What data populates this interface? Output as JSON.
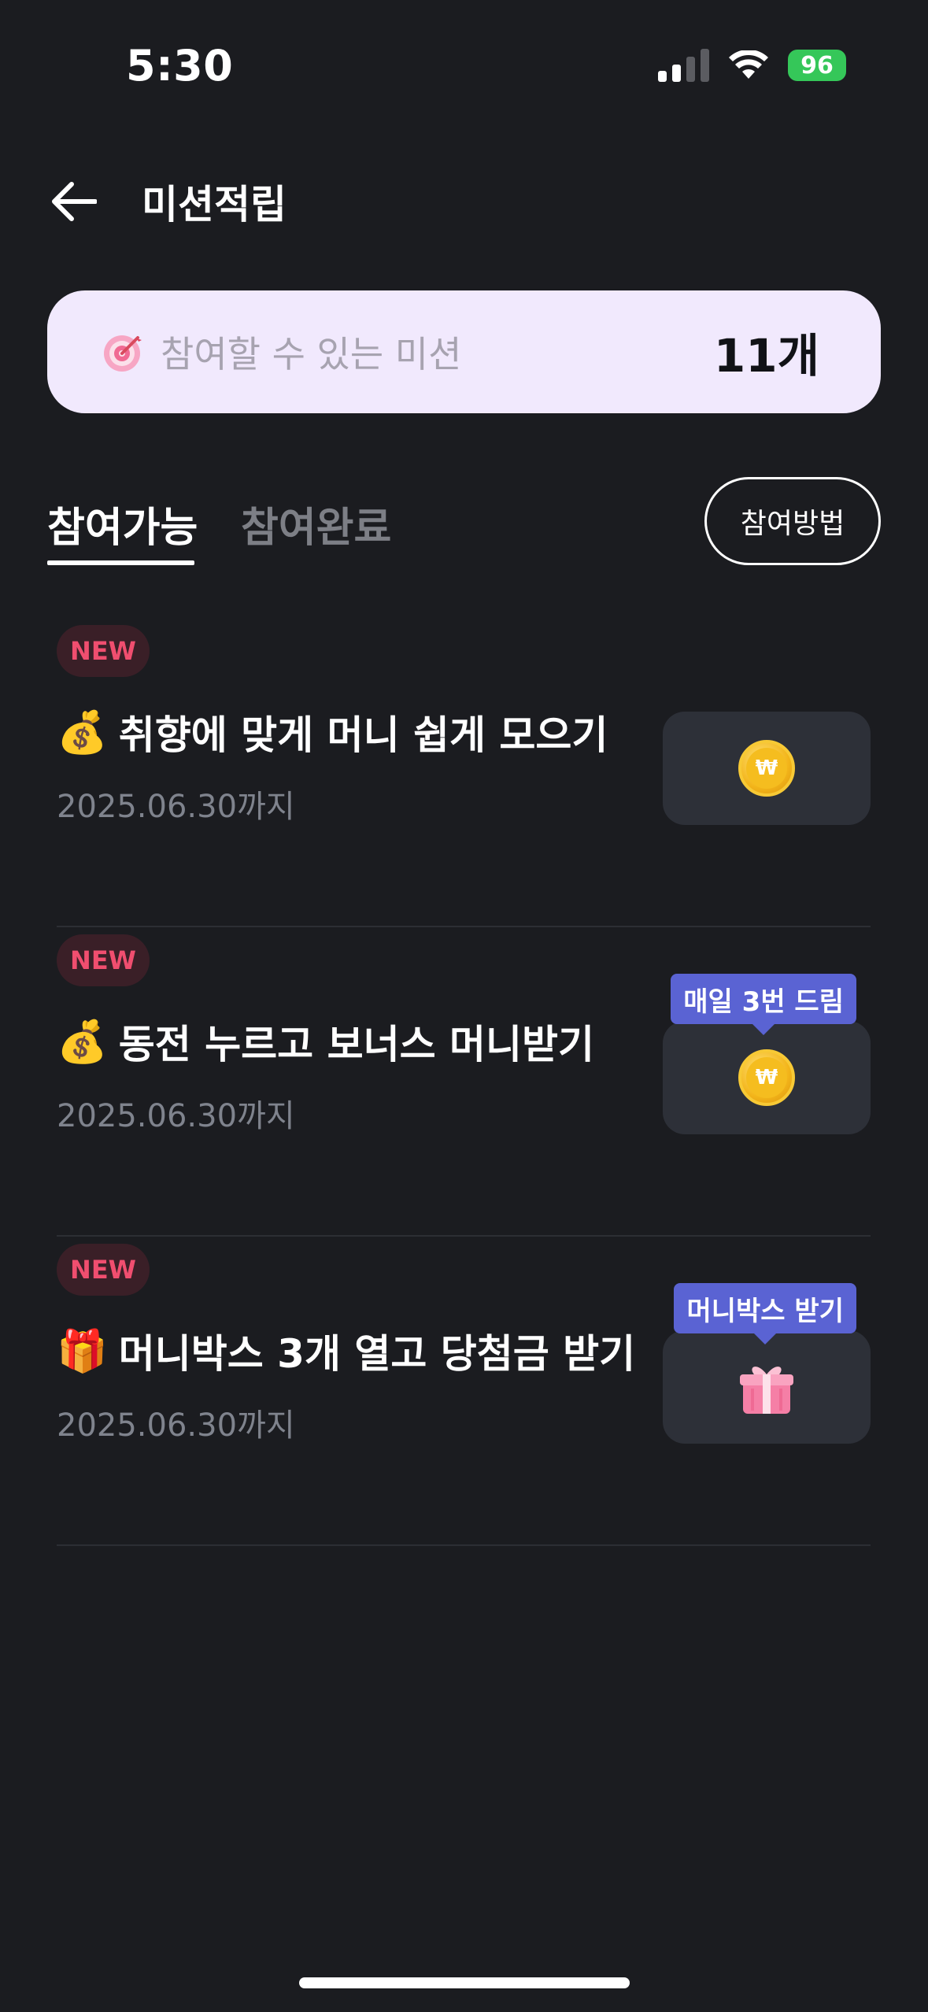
{
  "status_bar": {
    "time": "5:30",
    "battery": "96"
  },
  "header": {
    "title": "미션적립"
  },
  "summary": {
    "label": "참여할 수 있는 미션",
    "count": "11개"
  },
  "tabs": [
    {
      "label": "참여가능",
      "active": true
    },
    {
      "label": "참여완료",
      "active": false
    }
  ],
  "how_button": "참여방법",
  "missions": [
    {
      "badge": "NEW",
      "emoji": "💰",
      "title": "취향에 맞게 머니 쉽게 모으기",
      "date": "2025.06.30까지",
      "reward_icon": "coin-icon",
      "tooltip": ""
    },
    {
      "badge": "NEW",
      "emoji": "💰",
      "title": "동전 누르고 보너스 머니받기",
      "date": "2025.06.30까지",
      "reward_icon": "coin-icon",
      "tooltip": "매일 3번 드림"
    },
    {
      "badge": "NEW",
      "emoji": "🎁",
      "title": "머니박스 3개 열고 당첨금 받기",
      "date": "2025.06.30까지",
      "reward_icon": "gift-icon",
      "tooltip": "머니박스 받기"
    }
  ],
  "colors": {
    "background": "#1b1c20",
    "summary_bg": "#f1e9fd",
    "badge_text": "#f04e6f",
    "tooltip_bg": "#5a63d3",
    "battery": "#35c759"
  }
}
